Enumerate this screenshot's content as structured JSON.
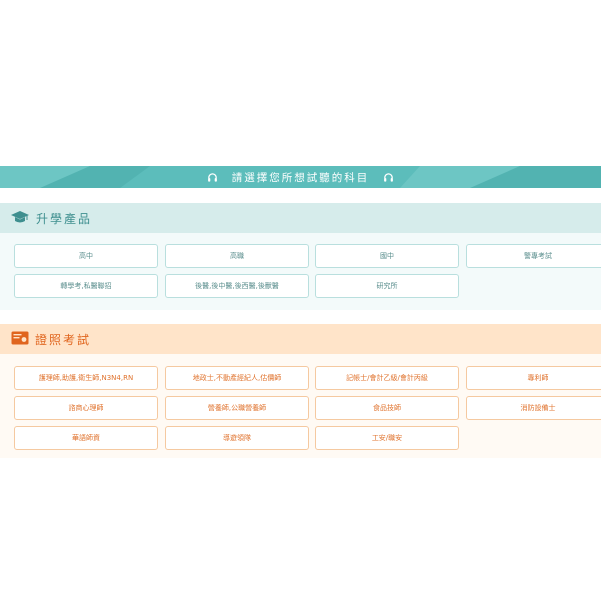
{
  "banner": {
    "title": "請選擇您所想試聽的科目"
  },
  "sections": [
    {
      "title": "升學產品",
      "items": [
        "高中",
        "高職",
        "國中",
        "警專考試",
        "轉學考,私醫聯招",
        "後醫,後中醫,後西醫,後獸醫",
        "研究所"
      ]
    },
    {
      "title": "證照考試",
      "items": [
        "護理師,助護,衛生師,N3N4,RN",
        "地政士,不動產經紀人,估價師",
        "記帳士/會計乙級/會計丙級",
        "專利師",
        "諮商心理師",
        "營養師,公職營養師",
        "食品技師",
        "消防設備士",
        "華語師資",
        "導遊領隊",
        "工安/職安"
      ]
    }
  ],
  "colors": {
    "teal": "#5cbdbb",
    "teal_text": "#3e8f8f",
    "orange": "#e0651e"
  },
  "icons": {
    "banner": "headphones-icon",
    "section1": "graduation-cap-icon",
    "section2": "certificate-icon"
  }
}
